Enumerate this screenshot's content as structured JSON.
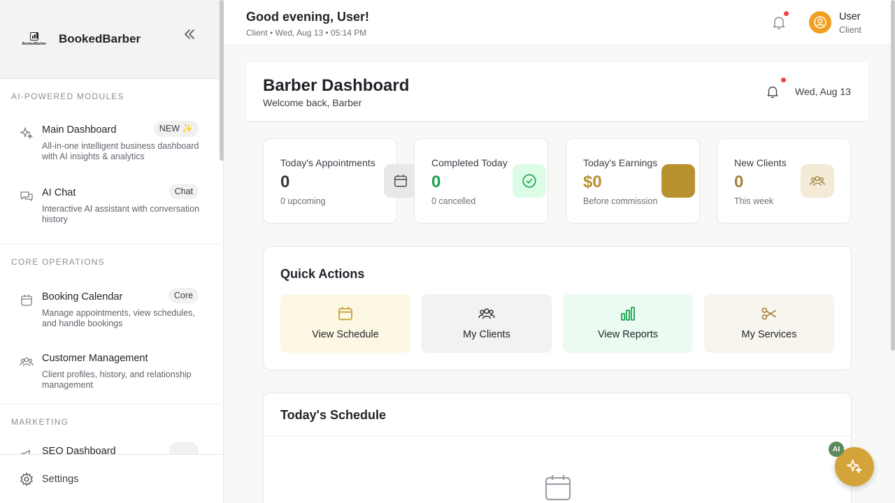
{
  "sidebar": {
    "brand": {
      "name": "BookedBarber",
      "logo_text": "BookedBarber"
    },
    "sections": [
      {
        "title": "AI-POWERED MODULES"
      },
      {
        "title": "CORE OPERATIONS"
      },
      {
        "title": "MARKETING"
      }
    ],
    "items": [
      {
        "title": "Main Dashboard",
        "badge": "NEW ✨",
        "desc": "All-in-one intelligent business dashboard with AI insights & analytics",
        "icon": "sparkles-icon"
      },
      {
        "title": "AI Chat",
        "badge": "Chat",
        "desc": "Interactive AI assistant with conversation history",
        "icon": "chat-icon"
      },
      {
        "title": "Booking Calendar",
        "badge": "Core",
        "desc": "Manage appointments, view schedules, and handle bookings",
        "icon": "calendar-icon"
      },
      {
        "title": "Customer Management",
        "badge": "",
        "desc": "Client profiles, history, and relationship management",
        "icon": "users-icon"
      },
      {
        "title": "SEO Dashboard",
        "badge": "",
        "desc": "",
        "icon": "megaphone-icon"
      }
    ],
    "settings_label": "Settings"
  },
  "topbar": {
    "greeting": "Good evening, User!",
    "subline": "Client • Wed, Aug 13 • 05:14 PM",
    "user_name": "User",
    "user_role": "Client"
  },
  "dashboard": {
    "title": "Barber Dashboard",
    "subtitle": "Welcome back, Barber",
    "date": "Wed, Aug 13"
  },
  "stats": [
    {
      "label": "Today's Appointments",
      "value": "0",
      "note": "0 upcoming",
      "color": "#2f3a33"
    },
    {
      "label": "Completed Today",
      "value": "0",
      "note": "0 cancelled",
      "color": "#16a34a"
    },
    {
      "label": "Today's Earnings",
      "value": "$0",
      "note": "Before commission",
      "color": "#b8922e"
    },
    {
      "label": "New Clients",
      "value": "0",
      "note": "This week",
      "color": "#a6823a"
    }
  ],
  "quick_actions": {
    "title": "Quick Actions",
    "buttons": [
      {
        "label": "View Schedule",
        "icon": "calendar-icon"
      },
      {
        "label": "My Clients",
        "icon": "users-icon"
      },
      {
        "label": "View Reports",
        "icon": "bar-chart-icon"
      },
      {
        "label": "My Services",
        "icon": "scissors-icon"
      }
    ]
  },
  "schedule": {
    "title": "Today's Schedule"
  },
  "fab": {
    "badge": "AI"
  },
  "colors": {
    "accent": "#d4a43a",
    "success": "#16a34a",
    "danger": "#ef4444"
  }
}
